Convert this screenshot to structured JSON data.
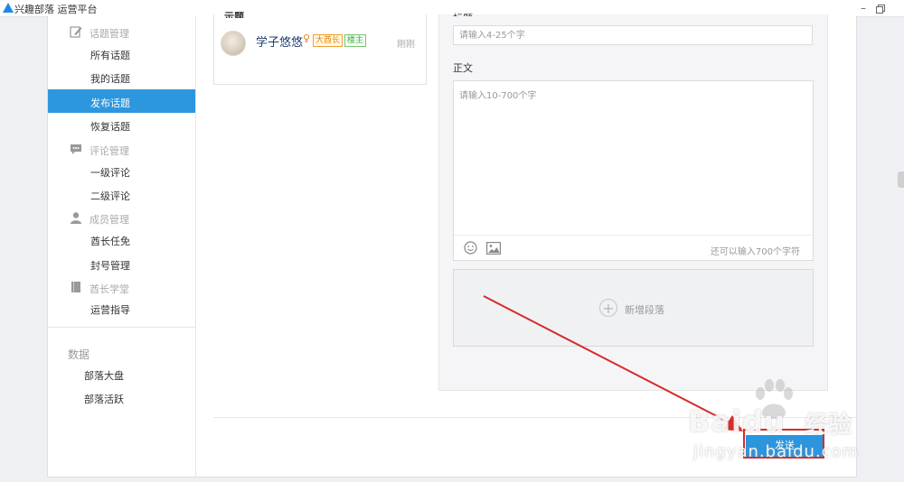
{
  "app": {
    "title": "兴趣部落 运营平台"
  },
  "sidebar": {
    "groups": [
      {
        "label": "话题管理",
        "icon": "edit-icon",
        "items": [
          "所有话题",
          "我的话题",
          "发布话题",
          "恢复话题"
        ]
      },
      {
        "label": "评论管理",
        "icon": "comment-icon",
        "items": [
          "一级评论",
          "二级评论"
        ]
      },
      {
        "label": "成员管理",
        "icon": "user-icon",
        "items": [
          "酋长任免",
          "封号管理"
        ]
      },
      {
        "label": "酋长学堂",
        "icon": "book-icon",
        "items": [
          "运营指导"
        ]
      }
    ],
    "active_item": "发布话题",
    "data_section": {
      "label": "数据",
      "items": [
        "部落大盘",
        "部落活跃"
      ]
    }
  },
  "post_preview": {
    "heading": "示题",
    "user_name": "学子悠悠",
    "badges": [
      "大酋长",
      "楼主"
    ],
    "time": "刚刚"
  },
  "editor": {
    "title_label": "标题",
    "title_placeholder": "请输入4-25个字",
    "body_label": "正文",
    "body_placeholder": "请输入10-700个字",
    "char_count": "还可以输入700个字符",
    "add_paragraph_label": "新增段落"
  },
  "footer": {
    "send_label": "发送"
  },
  "watermark": {
    "brand": "Baidu",
    "cn": "经验",
    "site": "jingyan.baidu.com"
  },
  "colors": {
    "accent": "#2d97de",
    "highlight": "#d62b2b"
  }
}
